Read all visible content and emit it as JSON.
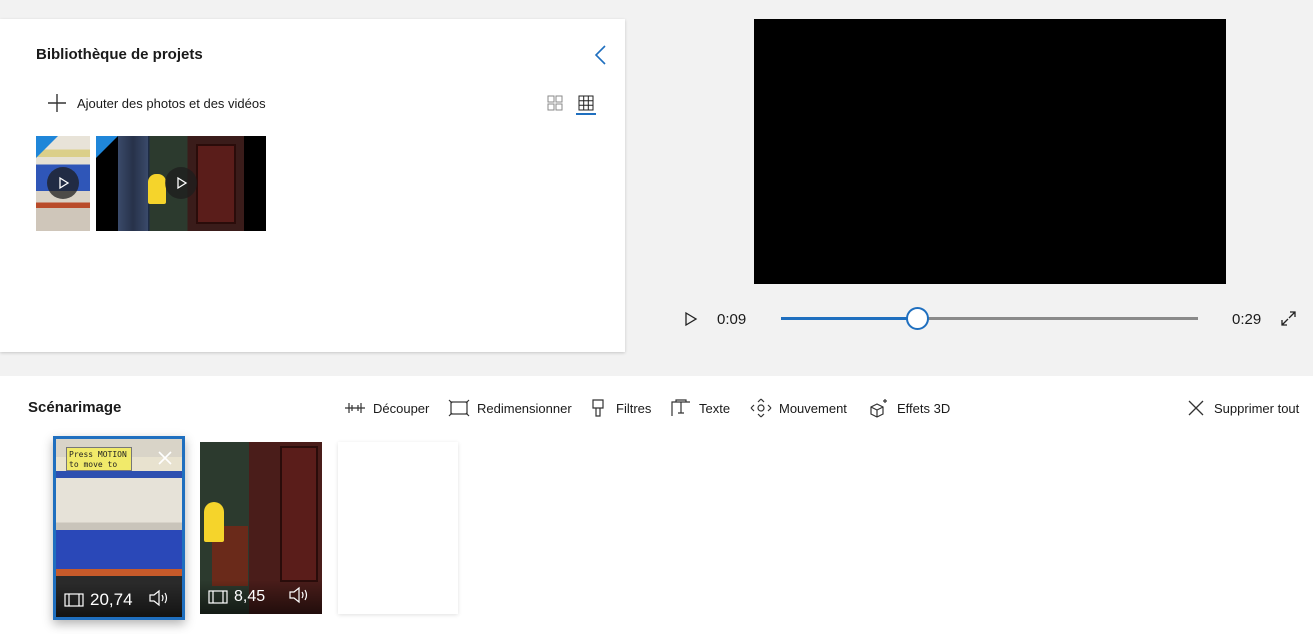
{
  "library": {
    "title": "Bibliothèque de projets",
    "add_label": "Ajouter des photos et des vidéos",
    "items": [
      {
        "name": "clip-1"
      },
      {
        "name": "clip-2"
      }
    ],
    "icons": {
      "collapse": "chevron-left-icon",
      "add": "plus-icon",
      "large_view": "grid-large-icon",
      "small_view": "grid-small-icon"
    },
    "accent": "#1f6fbf"
  },
  "player": {
    "current_time": "0:09",
    "total_time": "0:29",
    "progress": 0.327
  },
  "storyboard": {
    "title": "Scénarimage",
    "tools": {
      "trim": "Découper",
      "resize": "Redimensionner",
      "filters": "Filtres",
      "text": "Texte",
      "motion": "Mouvement",
      "effects3d": "Effets 3D",
      "delete_all": "Supprimer tout"
    },
    "clips": [
      {
        "duration": "20,74",
        "caption_lines": [
          "Press MOTION",
          "to move to"
        ]
      },
      {
        "duration": "8,45"
      }
    ]
  }
}
